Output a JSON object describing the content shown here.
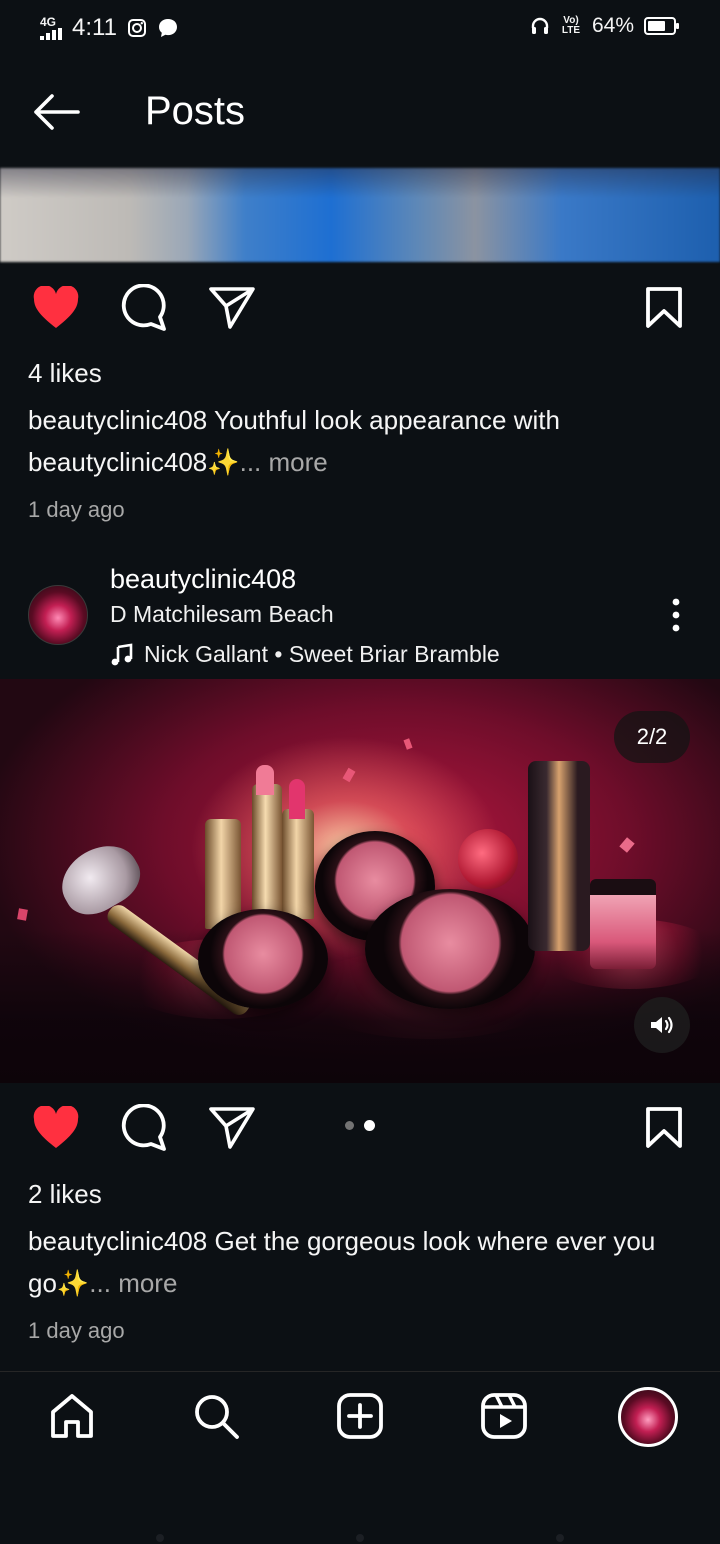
{
  "status_bar": {
    "network": "4G",
    "time": "4:11",
    "volte": "Vo) LTE",
    "battery": "64%"
  },
  "header": {
    "title": "Posts"
  },
  "post1": {
    "likes": "4 likes",
    "caption_user": "beautyclinic408",
    "caption_text": "Youthful look appearance with beautyclinic408✨",
    "more": "... more",
    "time": "1 day ago"
  },
  "post2": {
    "username": "beautyclinic408",
    "location": "D Matchilesam Beach",
    "music": "Nick Gallant • Sweet Briar Bramble",
    "image_counter": "2/2",
    "carousel": {
      "total": 2,
      "active": 2
    },
    "likes": "2 likes",
    "caption_user": "beautyclinic408",
    "caption_text": "Get the gorgeous look where ever you go✨",
    "more": "... more",
    "time": "1 day ago"
  },
  "colors": {
    "background": "#0c1014",
    "like_red": "#ff3040",
    "muted_text": "#a8a8a8"
  },
  "icons": {
    "back": "arrow-left-icon",
    "like": "heart-filled-icon",
    "comment": "comment-icon",
    "share": "send-icon",
    "save": "bookmark-icon",
    "options": "more-vertical-icon",
    "music": "music-note-icon",
    "volume": "speaker-icon",
    "nav": [
      "home-icon",
      "search-icon",
      "create-icon",
      "reels-icon",
      "profile-avatar"
    ]
  }
}
